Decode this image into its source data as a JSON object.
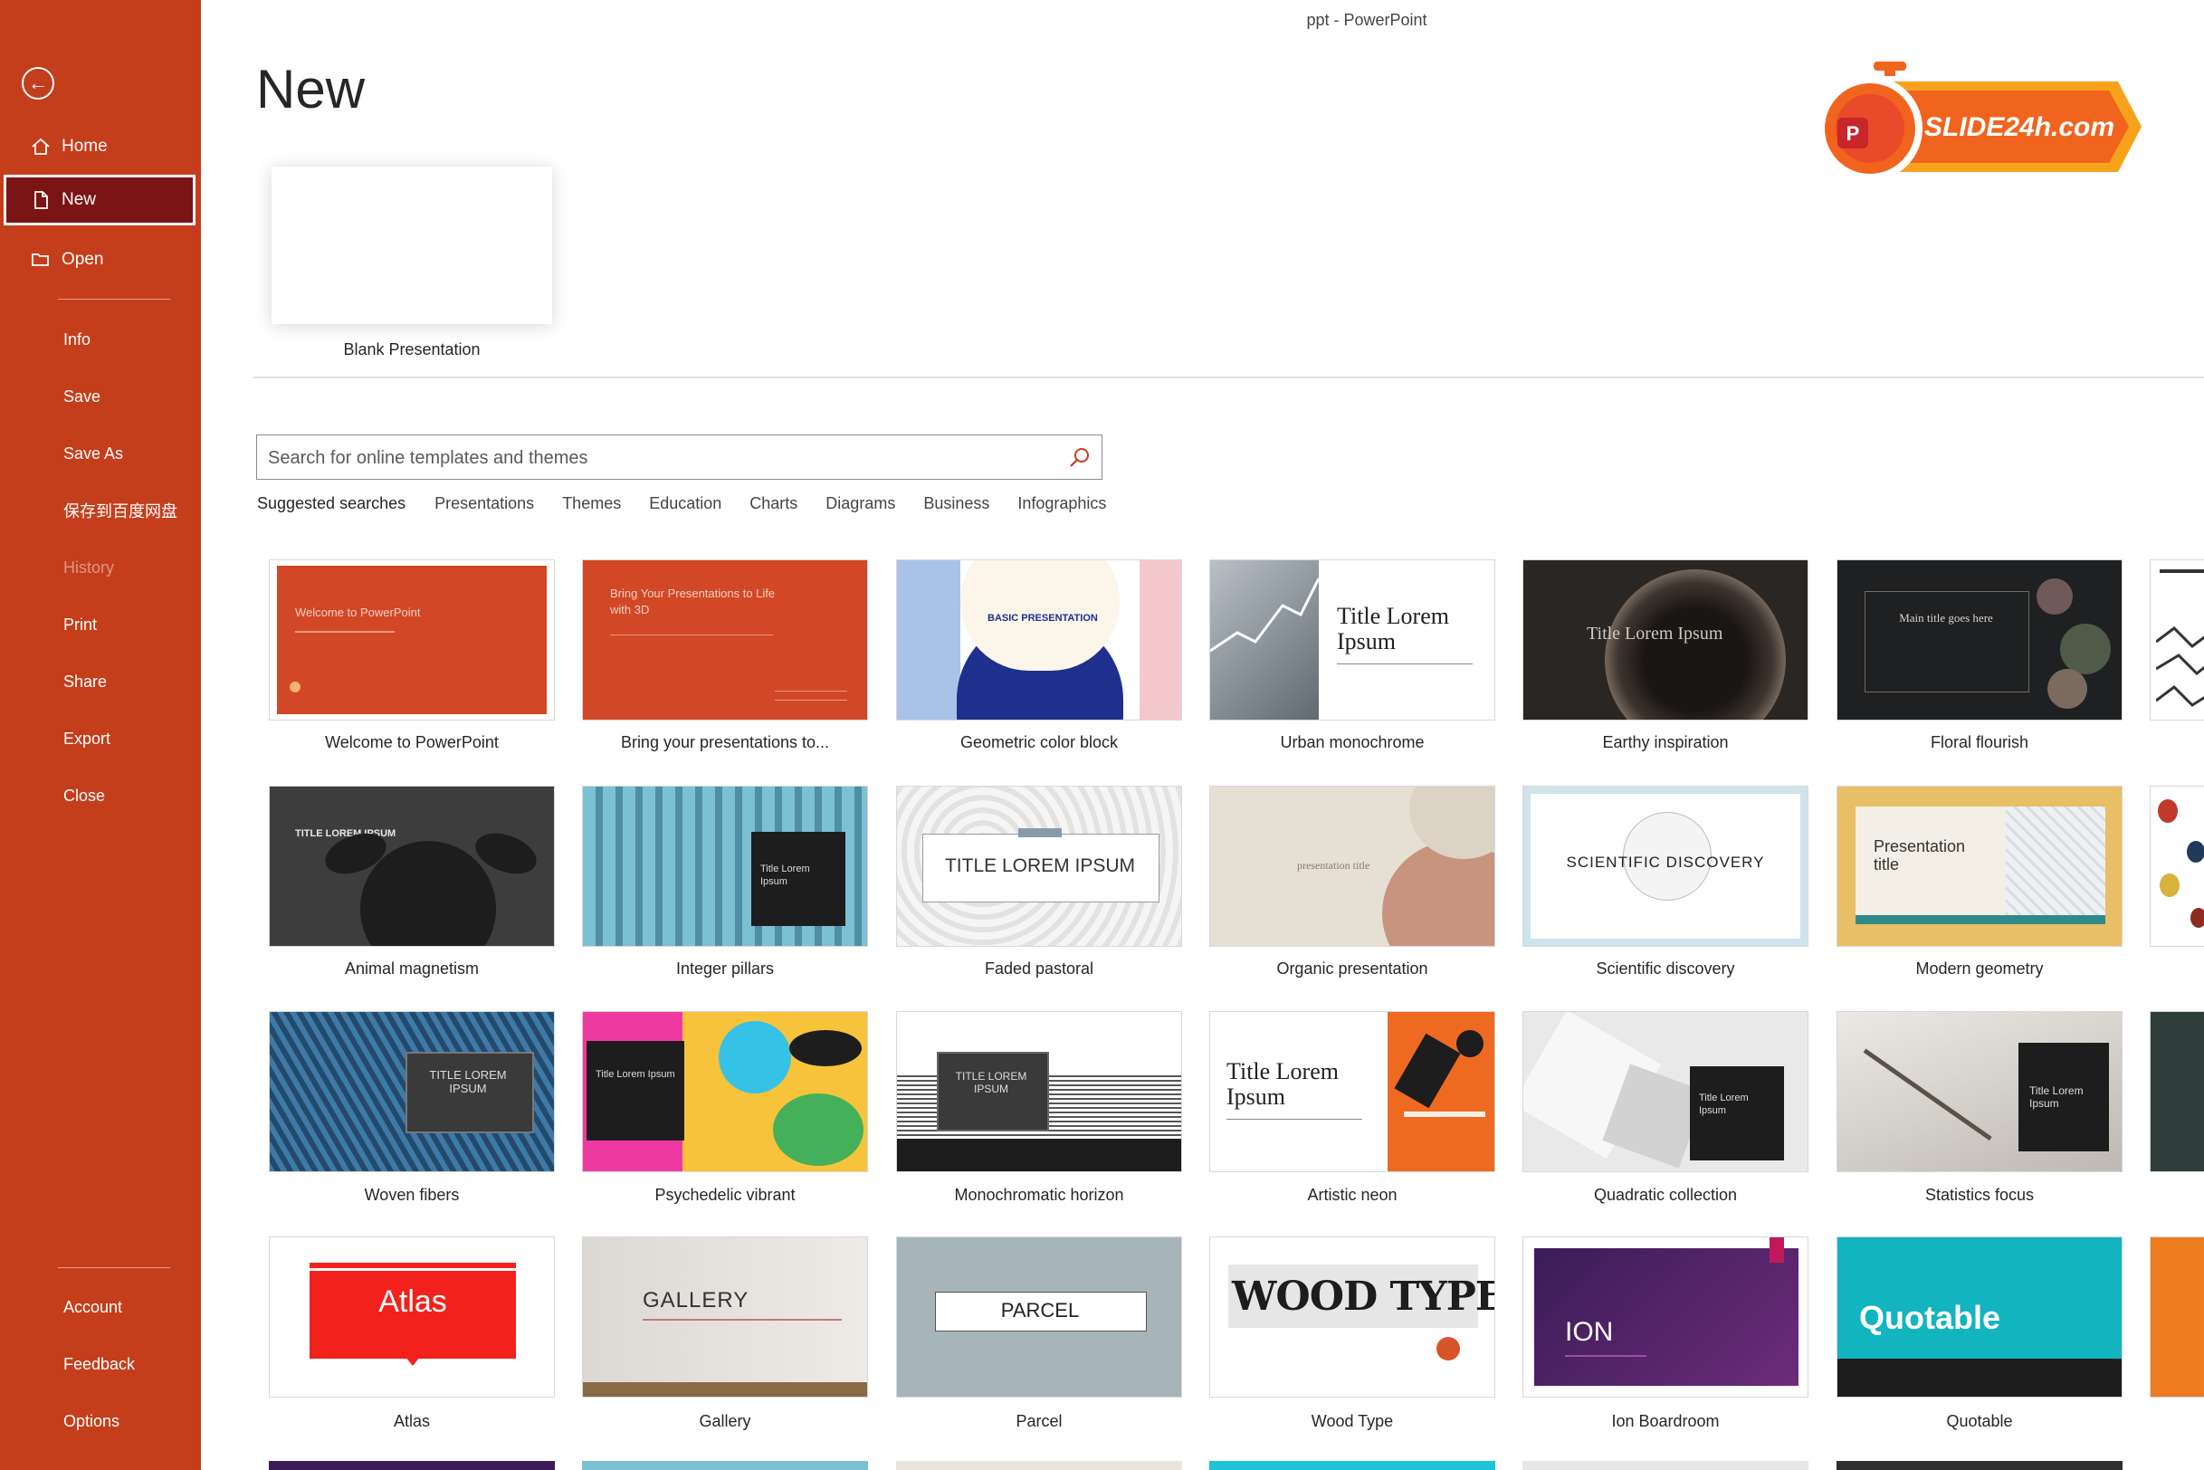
{
  "window": {
    "title": "ppt - PowerPoint"
  },
  "sidebar": {
    "items": [
      {
        "label": "Home"
      },
      {
        "label": "New"
      },
      {
        "label": "Open"
      },
      {
        "label": "Info"
      },
      {
        "label": "Save"
      },
      {
        "label": "Save As"
      },
      {
        "label": "保存到百度网盘"
      },
      {
        "label": "History"
      },
      {
        "label": "Print"
      },
      {
        "label": "Share"
      },
      {
        "label": "Export"
      },
      {
        "label": "Close"
      },
      {
        "label": "Account"
      },
      {
        "label": "Feedback"
      },
      {
        "label": "Options"
      }
    ]
  },
  "main": {
    "title": "New",
    "blank_label": "Blank Presentation",
    "search": {
      "placeholder": "Search for online templates and themes"
    },
    "suggested": {
      "label": "Suggested searches",
      "links": [
        "Presentations",
        "Themes",
        "Education",
        "Charts",
        "Diagrams",
        "Business",
        "Infographics"
      ]
    },
    "templates": [
      {
        "name": "Welcome to PowerPoint",
        "text": "Welcome to PowerPoint"
      },
      {
        "name": "Bring your presentations to...",
        "text": "Bring Your Presentations to Life with 3D"
      },
      {
        "name": "Geometric color block",
        "text": "BASIC PRESENTATION"
      },
      {
        "name": "Urban monochrome",
        "text": "Title Lorem Ipsum"
      },
      {
        "name": "Earthy inspiration",
        "text": "Title Lorem Ipsum"
      },
      {
        "name": "Floral flourish",
        "text": "Main title goes here"
      },
      {
        "name": "Animal magnetism",
        "text": "TITLE LOREM IPSUM"
      },
      {
        "name": "Integer pillars",
        "text": "Title Lorem Ipsum"
      },
      {
        "name": "Faded pastoral",
        "text": "TITLE LOREM IPSUM"
      },
      {
        "name": "Organic presentation",
        "text": "presentation title"
      },
      {
        "name": "Scientific discovery",
        "text": "SCIENTIFIC DISCOVERY"
      },
      {
        "name": "Modern geometry",
        "text": "Presentation title"
      },
      {
        "name": "Woven fibers",
        "text": "TITLE LOREM IPSUM"
      },
      {
        "name": "Psychedelic vibrant",
        "text": "Title Lorem Ipsum"
      },
      {
        "name": "Monochromatic horizon",
        "text": "TITLE LOREM IPSUM"
      },
      {
        "name": "Artistic neon",
        "text": "Title Lorem Ipsum"
      },
      {
        "name": "Quadratic collection",
        "text": "Title Lorem Ipsum"
      },
      {
        "name": "Statistics focus",
        "text": "Title Lorem Ipsum"
      },
      {
        "name": "Atlas",
        "text": "Atlas"
      },
      {
        "name": "Gallery",
        "text": "GALLERY"
      },
      {
        "name": "Parcel",
        "text": "PARCEL"
      },
      {
        "name": "Wood Type",
        "text": "WOOD TYPE"
      },
      {
        "name": "Ion Boardroom",
        "text": "ION"
      },
      {
        "name": "Quotable",
        "text": "Quotable"
      }
    ]
  },
  "watermark": {
    "text": "SLIDE24h.com",
    "badge": "P"
  },
  "colors": {
    "sidebar": "#c43e1c",
    "sidebar_active": "#7b1414",
    "accent_orange": "#d24726"
  }
}
